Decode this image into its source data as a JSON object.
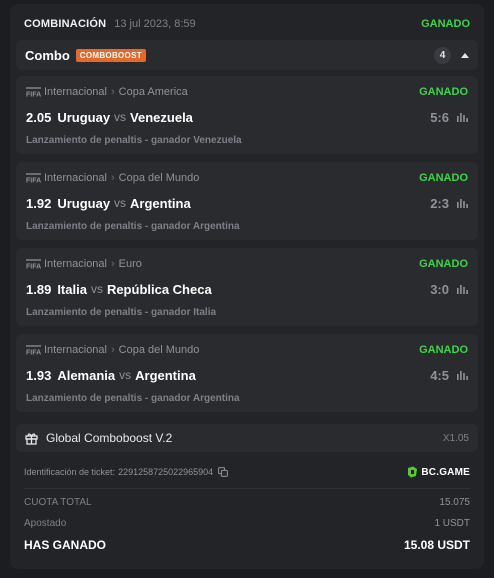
{
  "header": {
    "title": "COMBINACIÓN",
    "date": "13 jul 2023, 8:59",
    "status": "GANADO"
  },
  "combo": {
    "title": "Combo",
    "badge": "COMBOBOOST",
    "count": "4",
    "chevron_icon": "chevron-up-icon"
  },
  "bets": [
    {
      "league": "Internacional",
      "competition": "Copa America",
      "status": "GANADO",
      "odds": "2.05",
      "home": "Uruguay",
      "vs": "vs",
      "away": "Venezuela",
      "score": "5:6",
      "market": "Lanzamiento de penaltis - ganador Venezuela"
    },
    {
      "league": "Internacional",
      "competition": "Copa del Mundo",
      "status": "GANADO",
      "odds": "1.92",
      "home": "Uruguay",
      "vs": "vs",
      "away": "Argentina",
      "score": "2:3",
      "market": "Lanzamiento de penaltis - ganador Argentina"
    },
    {
      "league": "Internacional",
      "competition": "Euro",
      "status": "GANADO",
      "odds": "1.89",
      "home": "Italia",
      "vs": "vs",
      "away": "República Checa",
      "score": "3:0",
      "market": "Lanzamiento de penaltis - ganador Italia"
    },
    {
      "league": "Internacional",
      "competition": "Copa del Mundo",
      "status": "GANADO",
      "odds": "1.93",
      "home": "Alemania",
      "vs": "vs",
      "away": "Argentina",
      "score": "4:5",
      "market": "Lanzamiento de penaltis - ganador Argentina"
    }
  ],
  "boost": {
    "label": "Global Comboboost V.2",
    "value": "X1.05"
  },
  "ticket": {
    "label": "Identificación de ticket:",
    "id": "2291258725022965904",
    "brand": "BC.GAME"
  },
  "summary": {
    "odds_label": "CUOTA TOTAL",
    "odds_value": "15.075",
    "stake_label": "Apostado",
    "stake_value": "1 USDT",
    "win_label": "HAS GANADO",
    "win_value": "15.08 USDT"
  },
  "colors": {
    "background": "#1c1d20",
    "card": "#232427",
    "panel": "#2a2b2f",
    "won_green": "#3dd34d",
    "boost_orange": "#e4692b",
    "brand_green": "#58c83a"
  }
}
